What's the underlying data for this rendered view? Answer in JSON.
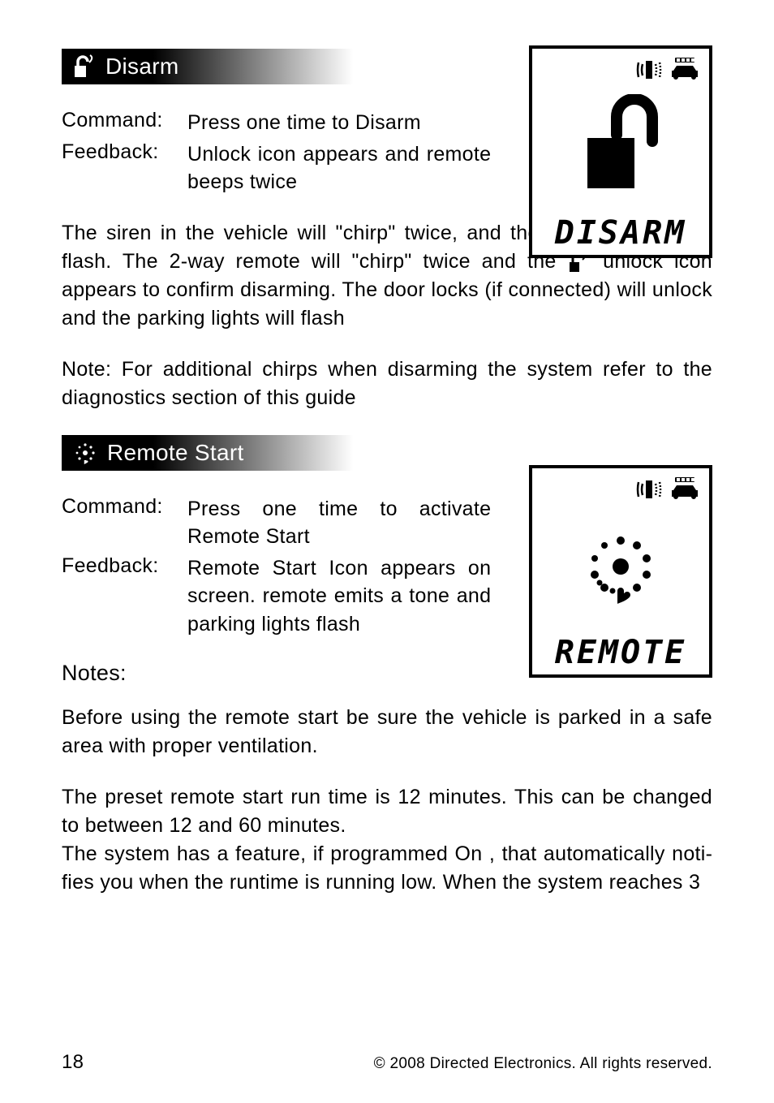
{
  "sections": {
    "disarm": {
      "title": "Disarm",
      "command_label": "Command",
      "command_value": "Press one time to Disarm",
      "feedback_label": "Feedback",
      "feedback_value": "Unlock icon appears and remote beeps twice",
      "body1a": "The siren in the vehicle will \"chirp\" twice, and the parking lights will flash. The 2-way remote will \"chirp\" ",
      "body1b": "twice",
      "body1c": " and the ",
      "body1d": " unlock icon appears to confirm disarming. The door locks (if connected) will unlock and the parking lights will flash",
      "note_label": "Note:",
      "note_text": " For additional chirps when disarming the system refer to the diagnostics section of this guide",
      "lcd_label": "DISARM"
    },
    "remote": {
      "title": "Remote Start",
      "command_label": "Command",
      "command_value": "Press one time to activate Remote Start",
      "feedback_label": "Feedback",
      "feedback_value": "Remote Start Icon appears on screen. remote emits a tone and parking lights flash",
      "notes_heading": "Notes:",
      "body1": "Before using the remote start be sure the vehicle is parked in a safe area with proper ventilation.",
      "body2": "The preset remote start run time is 12 minutes. This can be changed to between 12 and 60 minutes.",
      "body3": "The system has a feature, if programmed On , that automatically noti­fies you when the runtime is running low. When the system reaches 3",
      "lcd_label": "REMOTE"
    }
  },
  "footer": {
    "page": "18",
    "copyright": "© 2008 Directed Electronics. All rights reserved."
  }
}
